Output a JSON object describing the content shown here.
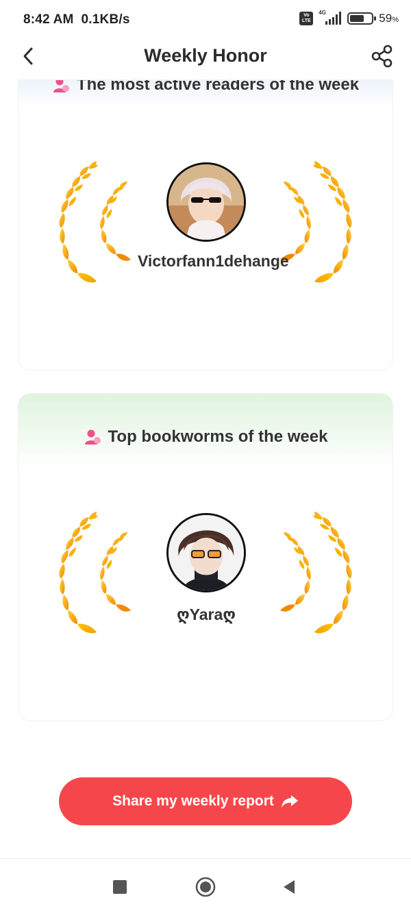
{
  "status_bar": {
    "time": "8:42 AM",
    "speed": "0.1KB/s",
    "volte_label": "Vo LTE",
    "network_label": "4G",
    "battery_percent": "59",
    "battery_unit": "%",
    "battery_level": 0.59
  },
  "header": {
    "title": "Weekly Honor",
    "back_icon": "chevron-left-icon",
    "share_icon": "share-nodes-icon"
  },
  "sections": [
    {
      "title": "The most active readers of the week",
      "icon": "person-icon",
      "user_name": "Victorfann1dehange",
      "avatar_icon": "avatar-white-hair-sunglasses"
    },
    {
      "title": "Top bookworms of the week",
      "icon": "person-icon",
      "user_name": "ღYaraღ",
      "avatar_icon": "avatar-dark-hair-glasses"
    }
  ],
  "share_button": {
    "label": "Share my weekly report",
    "icon": "share-arrow-icon"
  },
  "nav_bar": {
    "recents_icon": "square-icon",
    "home_icon": "circle-icon",
    "back_icon": "triangle-back-icon"
  },
  "colors": {
    "accent_red": "#f5474b",
    "laurel_gold": "#f7b500",
    "laurel_orange": "#f08a00",
    "person_pink": "#f0508a"
  }
}
